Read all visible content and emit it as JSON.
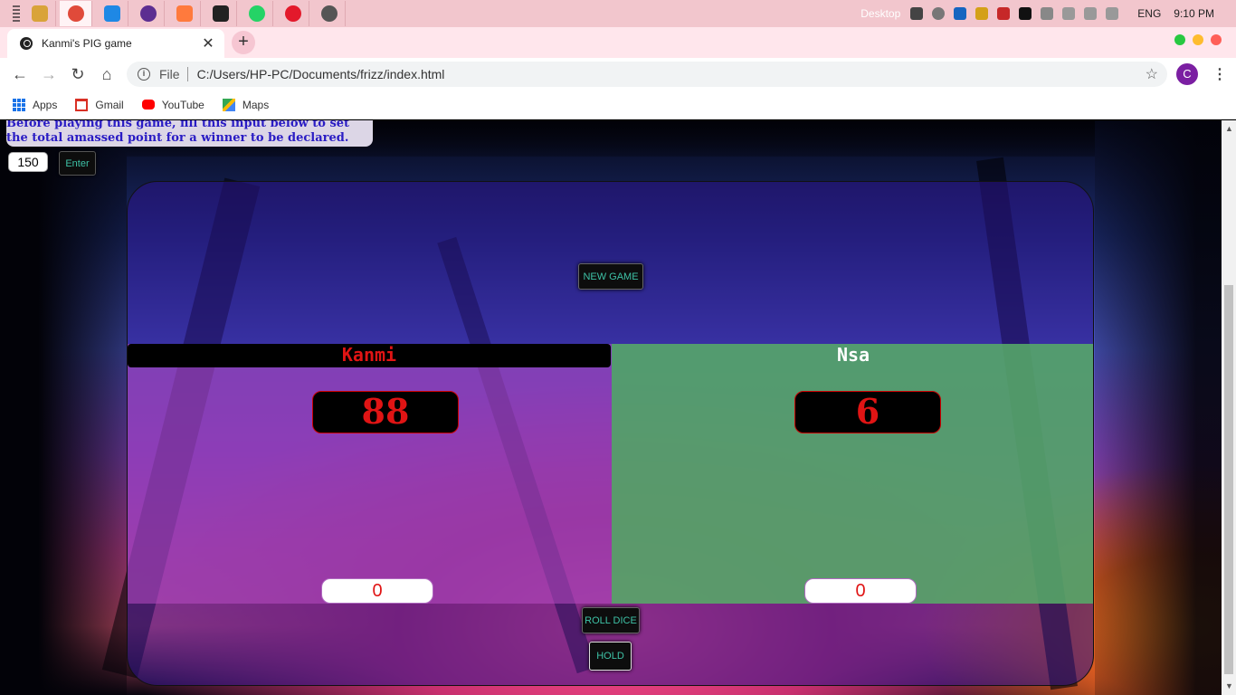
{
  "taskbar": {
    "apps": [
      {
        "name": "file-explorer",
        "color": "#d9a33a",
        "glyph": ""
      },
      {
        "name": "chrome",
        "color": "#e04a3a",
        "glyph": ""
      },
      {
        "name": "vscode",
        "color": "#1e88e5",
        "glyph": ""
      },
      {
        "name": "app-purple",
        "color": "#5c2e91",
        "glyph": ""
      },
      {
        "name": "app-orange",
        "color": "#ff7a3d",
        "glyph": ""
      },
      {
        "name": "app-dark",
        "color": "#222222",
        "glyph": ""
      },
      {
        "name": "whatsapp",
        "color": "#25d366",
        "glyph": ""
      },
      {
        "name": "opera",
        "color": "#e3192b",
        "glyph": ""
      },
      {
        "name": "app-w",
        "color": "#555555",
        "glyph": ""
      }
    ],
    "desktop_label": "Desktop",
    "language": "ENG",
    "time": "9:10 PM"
  },
  "browser": {
    "tab_title": "Kanmi's PIG game",
    "protocol_label": "File",
    "url": "C:/Users/HP-PC/Documents/frizz/index.html",
    "avatar_letter": "C",
    "bookmarks": [
      {
        "label": "Apps"
      },
      {
        "label": "Gmail"
      },
      {
        "label": "YouTube"
      },
      {
        "label": "Maps"
      }
    ]
  },
  "game": {
    "instruction": "Before playing this game, fill this input below to set the total amassed point for a winner to be declared.",
    "target_value": "150",
    "enter_label": "Enter",
    "new_game_label": "NEW GAME",
    "roll_dice_label": "ROLL DICE",
    "hold_label": "HOLD",
    "player1": {
      "name": "Kanmi",
      "score": "88",
      "current": "0"
    },
    "player2": {
      "name": "Nsa",
      "score": "6",
      "current": "0"
    }
  },
  "colors": {
    "active_name": "#e01414",
    "inactive_name": "#ffffff",
    "button_text": "#3ec2a6",
    "instruction_text": "#2a1cc4"
  }
}
